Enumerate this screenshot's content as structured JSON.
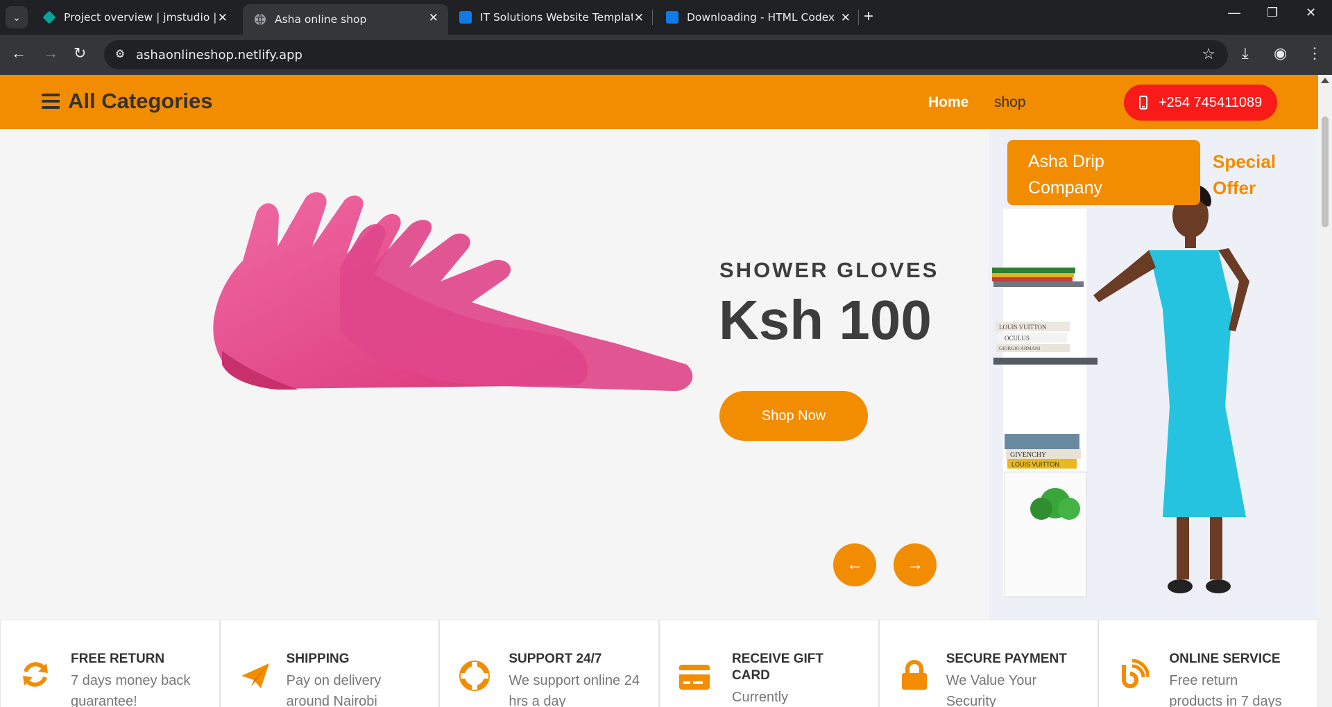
{
  "browser": {
    "tabs": [
      {
        "title": "Project overview | jmstudio | Ne",
        "favicon": "netlify-diamond-icon",
        "active": false
      },
      {
        "title": "Asha online shop",
        "favicon": "globe-icon",
        "active": true
      },
      {
        "title": "IT Solutions Website Template F",
        "favicon": "htmlcodex-icon",
        "active": false
      },
      {
        "title": "Downloading - HTML Codex",
        "favicon": "htmlcodex-icon",
        "active": false
      }
    ],
    "url": "ashaonlineshop.netlify.app"
  },
  "nav": {
    "categories_label": "All Categories",
    "links": [
      "Home",
      "shop"
    ],
    "phone": "+254 745411089"
  },
  "hero": {
    "product": "SHOWER GLOVES",
    "price": "Ksh 100",
    "cta": "Shop Now",
    "prev": "←",
    "next": "→"
  },
  "offer": {
    "badge": "Asha Drip Company",
    "title": "Special Offer",
    "book_labels": [
      "LOUIS VUITTON",
      "OCULUS",
      "GIORGIO ARMANI",
      "GIVENCHY",
      "LOUIS VUITTON"
    ]
  },
  "features": [
    {
      "title": "FREE RETURN",
      "text": "7 days money back guarantee!",
      "icon": "refresh-icon"
    },
    {
      "title": "SHIPPING",
      "text": "Pay on delivery around Nairobi",
      "icon": "paper-plane-icon"
    },
    {
      "title": "SUPPORT 24/7",
      "text": "We support online 24 hrs a day",
      "icon": "life-ring-icon"
    },
    {
      "title": "RECEIVE GIFT CARD",
      "text": "Currently Unvailable",
      "icon": "credit-card-icon"
    },
    {
      "title": "SECURE PAYMENT",
      "text": "We Value Your Security",
      "icon": "lock-icon"
    },
    {
      "title": "ONLINE SERVICE",
      "text": "Free return products in 7 days",
      "icon": "blog-icon"
    }
  ],
  "colors": {
    "accent": "#f28c00",
    "phone_button": "#f91a1a",
    "text_dark": "#3d3d3d"
  }
}
